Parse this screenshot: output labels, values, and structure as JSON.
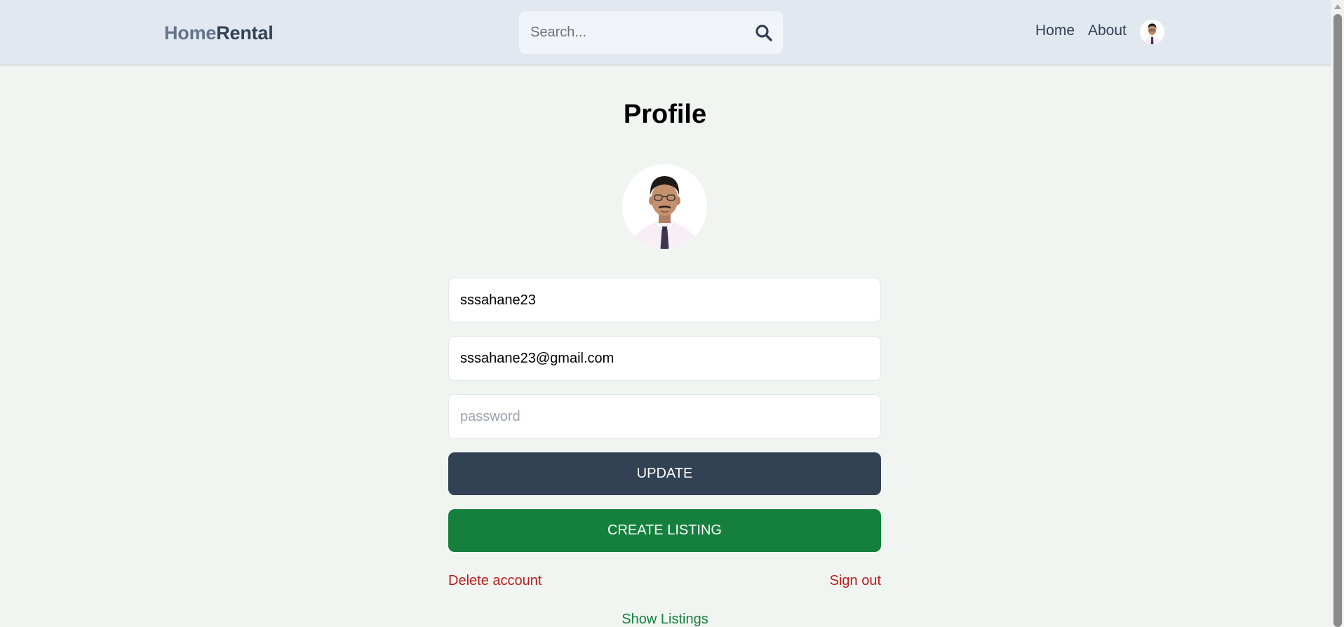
{
  "header": {
    "logo_part1": "Home",
    "logo_part2": "Rental",
    "search_placeholder": "Search...",
    "search_icon": "search-icon",
    "nav": {
      "home": "Home",
      "about": "About"
    },
    "avatar": "user-avatar"
  },
  "profile": {
    "title": "Profile",
    "avatar": "profile-photo",
    "username_value": "sssahane23",
    "email_value": "sssahane23@gmail.com",
    "password_placeholder": "password",
    "update_label": "UPDATE",
    "create_listing_label": "CREATE LISTING",
    "delete_account_label": "Delete account",
    "sign_out_label": "Sign out",
    "show_listings_label": "Show Listings"
  },
  "colors": {
    "header_bg": "#e2e8f0",
    "page_bg": "#f1f5f1",
    "update_button": "#334155",
    "create_button": "#15803d",
    "danger_link": "#b91c1c",
    "success_link": "#15803d"
  }
}
